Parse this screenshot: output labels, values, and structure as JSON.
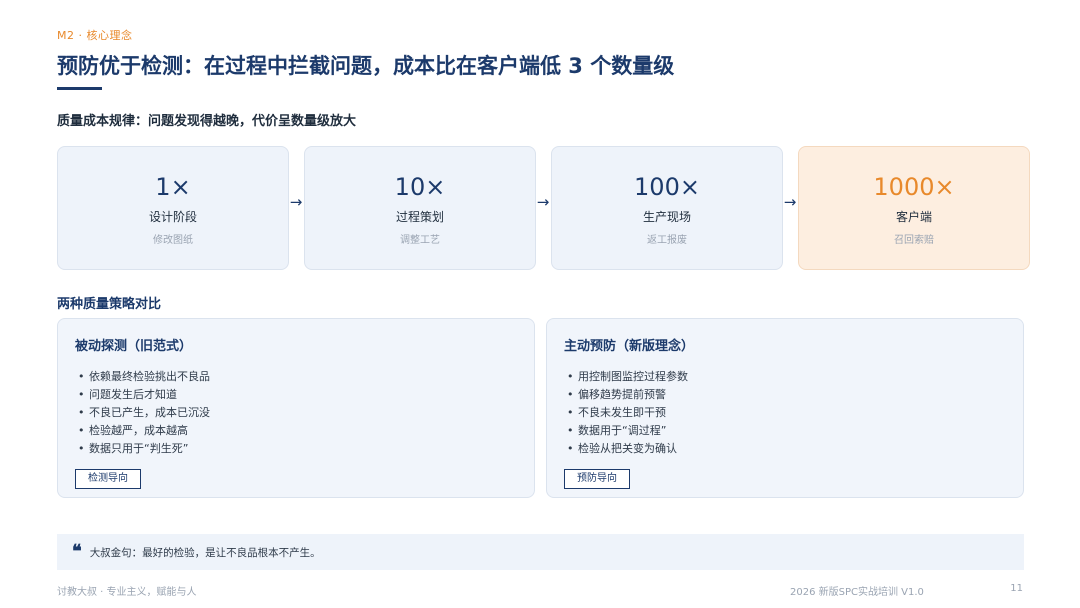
{
  "header": {
    "tag": "M2 · 核心理念",
    "title": "预防优于检测：在过程中拦截问题，成本比在客户端低 3 个数量级",
    "subtitle": "质量成本规律：问题发现得越晚，代价呈数量级放大"
  },
  "stages": [
    {
      "multiplier": "1×",
      "name": "设计阶段",
      "desc": "修改图纸"
    },
    {
      "multiplier": "10×",
      "name": "过程策划",
      "desc": "调整工艺"
    },
    {
      "multiplier": "100×",
      "name": "生产现场",
      "desc": "返工报废"
    },
    {
      "multiplier": "1000×",
      "name": "客户端",
      "desc": "召回索赔"
    }
  ],
  "arrow_glyph": "→",
  "comparison": {
    "title": "两种质量策略对比",
    "left": {
      "title": "被动探测（旧范式）",
      "items": [
        "依赖最终检验挑出不良品",
        "问题发生后才知道",
        "不良已产生，成本已沉没",
        "检验越严，成本越高",
        "数据只用于“判生死”"
      ],
      "tag": "检测导向"
    },
    "right": {
      "title": "主动预防（新版理念）",
      "items": [
        "用控制图监控过程参数",
        "偏移趋势提前预警",
        "不良未发生即干预",
        "数据用于“调过程”",
        "检验从把关变为确认"
      ],
      "tag": "预防导向"
    }
  },
  "quote": {
    "icon": "quote-icon",
    "text": "大叔金句：最好的检验，是让不良品根本不产生。"
  },
  "footer": {
    "left": "讨教大叔 · 专业主义，赋能与人",
    "right": "2026 新版SPC实战培训 V1.0",
    "page": "11"
  },
  "colors": {
    "primary": "#1c3a6b",
    "accent": "#e8892b",
    "card_bg": "#eef3fa",
    "hot_bg": "#fdeee0"
  }
}
